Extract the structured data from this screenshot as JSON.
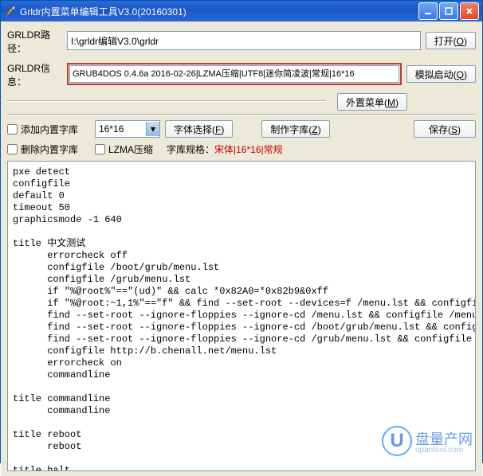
{
  "title": "Grldr内置菜单编辑工具V3.0(20160301)",
  "labels": {
    "path": "GRLDR路径：",
    "info": "GRLDR信息：",
    "ext": "外置菜单",
    "open": "打开",
    "sim": "模拟启动",
    "font": "字体选择",
    "make": "制作字库",
    "save": "保存",
    "ext_k": "M",
    "open_k": "O",
    "sim_k": "Q",
    "font_k": "F",
    "make_k": "Z",
    "save_k": "S"
  },
  "path_value": "I:\\grldr编辑V3.0\\grldr",
  "info_value": "GRUB4DOS 0.4.6a 2016-02-26|LZMA压缩|UTF8|迷你简凌波|常规|16*16",
  "chk_add": "添加内置字库",
  "chk_del": "删除内置字库",
  "chk_lzma": "LZMA压缩",
  "combo": "16*16",
  "spec_label": "字库规格：",
  "spec_value": "宋体|16*16|常规",
  "editor": "pxe detect\nconfigfile\ndefault 0\ntimeout 50\ngraphicsmode -1 640\n\ntitle 中文测试\n      errorcheck off\n      configfile /boot/grub/menu.lst\n      configfile /grub/menu.lst\n      if \"%@root%\"==\"(ud)\" && calc *0x82A0=*0x82b9&0xff\n      if \"%@root:~1,1%\"==\"f\" && find --set-root --devices=f /menu.lst && configfile /menu.l\n      find --set-root --ignore-floppies --ignore-cd /menu.lst && configfile /menu.lst\n      find --set-root --ignore-floppies --ignore-cd /boot/grub/menu.lst && configfile /boot\n      find --set-root --ignore-floppies --ignore-cd /grub/menu.lst && configfile /grub/menu\n      configfile http://b.chenall.net/menu.lst\n      errorcheck on\n      commandline\n\ntitle commandline\n      commandline\n\ntitle reboot\n      reboot\n\ntitle halt\n      halt",
  "watermark": {
    "logo": "U",
    "cn": "盘量产网",
    "sub": "upantool.com"
  }
}
